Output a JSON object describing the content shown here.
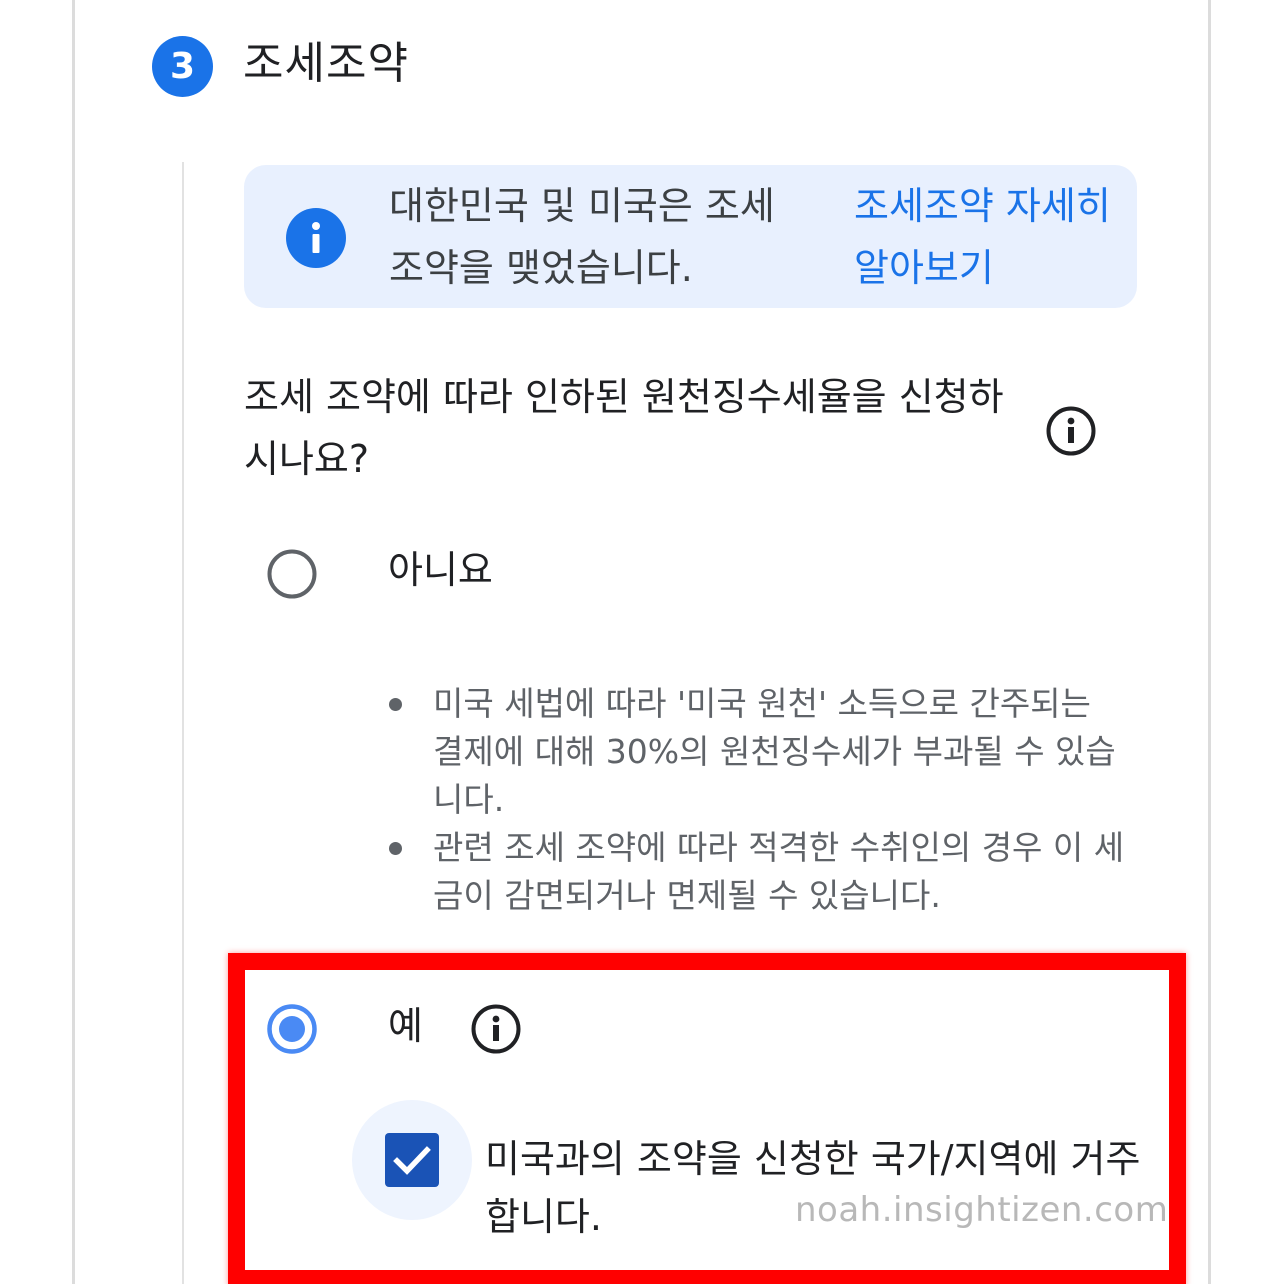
{
  "step": {
    "number": "3",
    "title": "조세조약"
  },
  "banner": {
    "text": "대한민국 및 미국은 조세 조약을 맺었습니다.",
    "link": "조세조약 자세히 알아보기"
  },
  "question": {
    "text": "조세 조약에 따라 인하된 원천징수세율을 신청하시나요?"
  },
  "options": {
    "no": {
      "label": "아니요",
      "selected": false
    },
    "yes": {
      "label": "예",
      "selected": true
    }
  },
  "bullets": [
    "미국 세법에 따라 '미국 원천' 소득으로 간주되는 결제에 대해 30%의 원천징수세가 부과될 수 있습니다.",
    "관련 조세 조약에 따라 적격한 수취인의 경우 이 세금이 감면되거나 면제될 수 있습니다."
  ],
  "checkbox": {
    "label": "미국과의 조약을 신청한 국가/지역에 거주합니다.",
    "checked": true
  },
  "watermark": "noah.insightizen.com",
  "colors": {
    "accent": "#1a73e8",
    "banner_bg": "#e8f0fe",
    "checkbox": "#1a53b6",
    "highlight": "#ff0000"
  }
}
